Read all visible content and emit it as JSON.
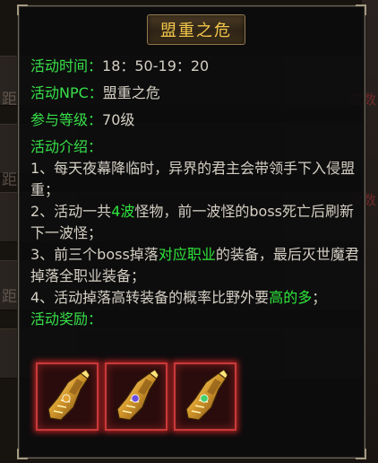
{
  "panel": {
    "title": "盟重之危"
  },
  "info": {
    "time_label": "活动时间：",
    "time_value": "18：50-19：20",
    "npc_label": "活动NPC：",
    "npc_value": "盟重之危",
    "level_label": "参与等级：",
    "level_value": "70级"
  },
  "intro": {
    "label": "活动介绍：",
    "p1": "1、每天夜幕降临时，异界的君主会带领手下入侵盟重；",
    "p2a": "2、活动一共",
    "p2b": "4波",
    "p2c": "怪物，前一波怪的boss死亡后刷新下一波怪；",
    "p3a": "3、前三个boss掉落",
    "p3b": "对应职业",
    "p3c": "的装备，最后灭世魔君掉落全职业装备；",
    "p4a": "4、活动掉落高转装备的概率比野外要",
    "p4b": "高的多",
    "p4c": "；"
  },
  "reward": {
    "label": "活动奖励：",
    "items": [
      {
        "icon": "gold-gauntlet-icon",
        "gem": "#e0a030"
      },
      {
        "icon": "gold-gauntlet-icon",
        "gem": "#6a4de0"
      },
      {
        "icon": "gold-gauntlet-icon",
        "gem": "#3fd06a"
      }
    ]
  },
  "background": {
    "right_text_1": "次数",
    "right_text_2": "次数",
    "left_text": "距"
  },
  "colors": {
    "title": "#f3c64b",
    "label_green": "#37e049",
    "body_text": "#d4cfc3",
    "slot_border": "#c83a3a"
  }
}
